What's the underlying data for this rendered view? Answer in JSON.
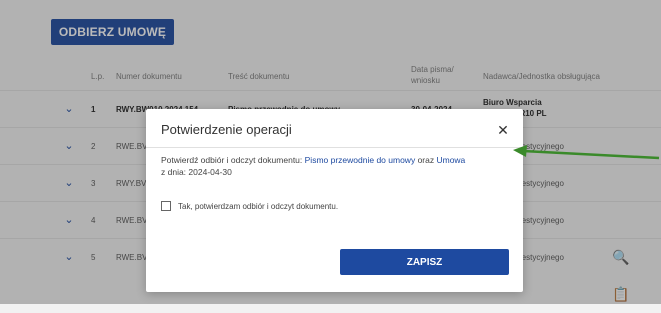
{
  "top_button": "ODBIERZ UMOWĘ",
  "columns": {
    "lp": "L.p.",
    "number": "Numer dokumentu",
    "content": "Treść dokumentu",
    "date_line1": "Data pisma/",
    "date_line2": "wniosku",
    "office": "Nadawca/Jednostka obsługująca"
  },
  "rows": [
    {
      "lp": "1",
      "num": "RWY.BW010.2024.154",
      "content": "Pismo przewodnie do umowy",
      "date": "30-04-2024",
      "office_line1": "Biuro Wsparcia",
      "office_line2": "...jnego OR10 PL"
    },
    {
      "lp": "2",
      "num": "RWE.BV",
      "office": "...arcia Inwestycyjnego"
    },
    {
      "lp": "3",
      "num": "RWY.BV",
      "office": "...arcia Inwestycyjnego"
    },
    {
      "lp": "4",
      "num": "RWE.BV",
      "office": "...arcia Inwestycyjnego"
    },
    {
      "lp": "5",
      "num": "RWE.BV",
      "office": "...arcia Inwestycyjnego"
    }
  ],
  "modal": {
    "title": "Potwierdzenie operacji",
    "msg_prefix": "Potwierdź odbiór i odczyt dokumentu: ",
    "link1": "Pismo przewodnie do umowy",
    "msg_mid": " oraz ",
    "link2": "Umowa",
    "msg_suffix": "z dnia: 2024-04-30",
    "checkbox_label": "Tak, potwierdzam odbiór i odczyt dokumentu.",
    "save_button": "ZAPISZ"
  },
  "colors": {
    "primary": "#1e4aa0",
    "arrow": "#3a8a2a"
  }
}
